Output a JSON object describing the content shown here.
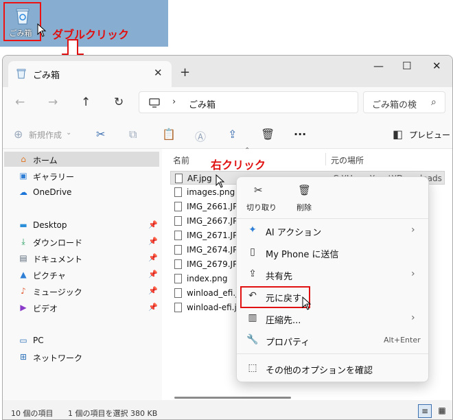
{
  "desktop": {
    "recycle_bin_label": "ごみ箱"
  },
  "annotations": {
    "double_click": "ダブルクリック",
    "right_click": "右クリック"
  },
  "window": {
    "tab_title": "ごみ箱",
    "address": "ごみ箱",
    "search_placeholder": "ごみ箱の検",
    "new_label": "新規作成",
    "preview_label": "プレビュー"
  },
  "sidebar": {
    "items": [
      {
        "label": "ホーム",
        "icon": "home-icon",
        "pinned": false,
        "selected": true
      },
      {
        "label": "ギャラリー",
        "icon": "gallery-icon",
        "pinned": false
      },
      {
        "label": "OneDrive",
        "icon": "onedrive-icon",
        "pinned": false
      },
      {
        "label": "Desktop",
        "icon": "desktop-icon",
        "pinned": true
      },
      {
        "label": "ダウンロード",
        "icon": "download-icon",
        "pinned": true
      },
      {
        "label": "ドキュメント",
        "icon": "document-icon",
        "pinned": true
      },
      {
        "label": "ピクチャ",
        "icon": "pictures-icon",
        "pinned": true
      },
      {
        "label": "ミュージック",
        "icon": "music-icon",
        "pinned": true
      },
      {
        "label": "ビデオ",
        "icon": "video-icon",
        "pinned": true
      },
      {
        "label": "PC",
        "icon": "pc-icon",
        "pinned": false
      },
      {
        "label": "ネットワーク",
        "icon": "network-icon",
        "pinned": false
      }
    ]
  },
  "columns": {
    "name": "名前",
    "location": "元の場所"
  },
  "files": [
    {
      "name": "AF.jpg",
      "location": "C:¥Users¥root¥Downloads"
    },
    {
      "name": "images.png"
    },
    {
      "name": "IMG_2661.JPG"
    },
    {
      "name": "IMG_2667.JPG"
    },
    {
      "name": "IMG_2671.JPG"
    },
    {
      "name": "IMG_2674.JPG"
    },
    {
      "name": "IMG_2679.JPG"
    },
    {
      "name": "index.png"
    },
    {
      "name": "winload_efi.jp"
    },
    {
      "name": "winload-efi.jp"
    }
  ],
  "context_menu": {
    "cut_label": "切り取り",
    "delete_label": "削除",
    "items": [
      {
        "label": "AI アクション",
        "icon": "ai-sparkle-icon",
        "submenu": true
      },
      {
        "label": "My Phone に送信",
        "icon": "phone-icon",
        "submenu": false
      },
      {
        "label": "共有先",
        "icon": "share-icon",
        "submenu": true
      },
      {
        "label": "元に戻す",
        "icon": "restore-icon",
        "submenu": false
      },
      {
        "label": "圧縮先...",
        "icon": "zip-icon",
        "submenu": true
      },
      {
        "label": "プロパティ",
        "icon": "wrench-icon",
        "submenu": false,
        "shortcut": "Alt+Enter"
      },
      {
        "label": "その他のオプションを確認",
        "icon": "more-options-icon",
        "submenu": false
      }
    ]
  },
  "status": {
    "count": "10 個の項目",
    "selection": "1 個の項目を選択 380 KB"
  },
  "colors": {
    "annotation_red": "#e01010",
    "accent": "#3b6fb0"
  }
}
